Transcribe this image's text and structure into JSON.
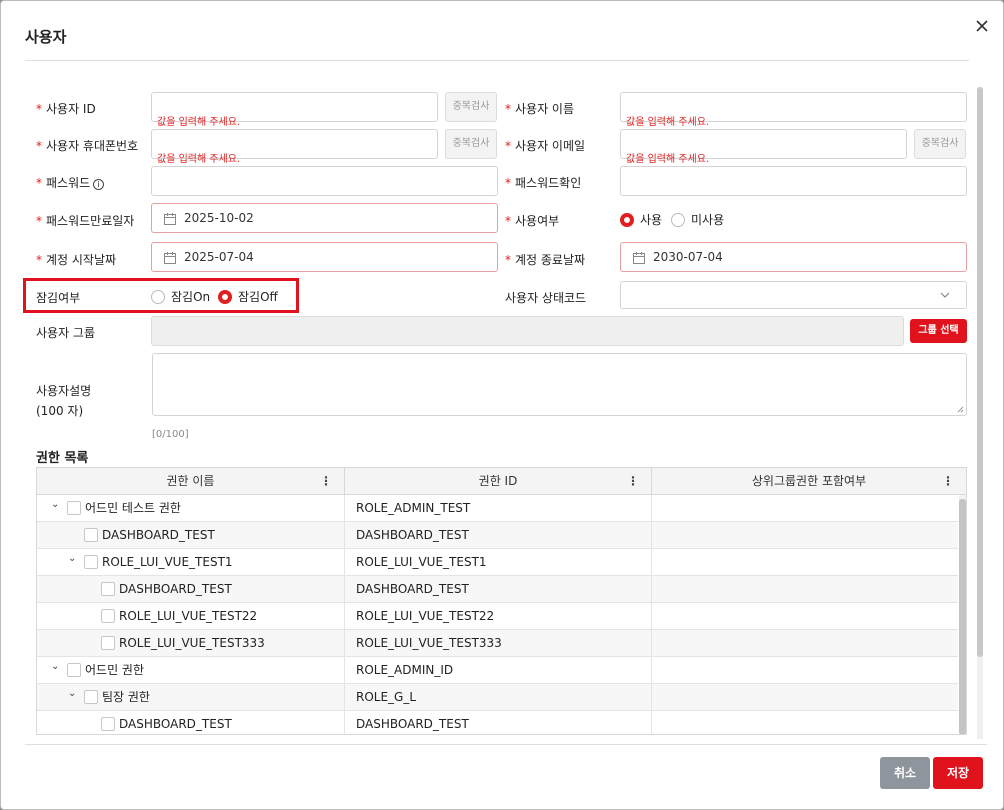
{
  "dialog": {
    "title": "사용자"
  },
  "form": {
    "user_id": {
      "label": "사용자 ID",
      "value": "",
      "error": "값을 입력해 주세요.",
      "dup_check": "중복검사"
    },
    "user_name": {
      "label": "사용자 이름",
      "value": "",
      "error": "값을 입력해 주세요."
    },
    "mobile": {
      "label": "사용자 휴대폰번호",
      "value": "",
      "error": "값을 입력해 주세요.",
      "dup_check": "중복검사"
    },
    "email": {
      "label": "사용자 이메일",
      "value": "",
      "error": "값을 입력해 주세요.",
      "dup_check": "중복검사"
    },
    "password": {
      "label": "패스워드",
      "info_icon": "i",
      "value": ""
    },
    "password_confirm": {
      "label": "패스워드확인",
      "value": ""
    },
    "password_expiry": {
      "label": "패스워드만료일자",
      "value": "2025-10-02"
    },
    "use_yn": {
      "label": "사용여부",
      "options": [
        "사용",
        "미사용"
      ],
      "selected": "사용"
    },
    "account_start": {
      "label": "계정 시작날짜",
      "value": "2025-07-04"
    },
    "account_end": {
      "label": "계정 종료날짜",
      "value": "2030-07-04"
    },
    "lock": {
      "label": "잠김여부",
      "options": [
        "잠김On",
        "잠김Off"
      ],
      "selected": "잠김Off"
    },
    "status_code": {
      "label": "사용자 상태코드",
      "value": ""
    },
    "user_group": {
      "label": "사용자 그룹",
      "value": "",
      "button": "그룹 선택"
    },
    "description": {
      "label_line1": "사용자설명",
      "label_line2": "(100 자)",
      "value": "",
      "counter": "[0/100]"
    }
  },
  "permissions": {
    "title": "권한 목록",
    "columns": [
      "권한 이름",
      "권한 ID",
      "상위그룹권한 포함여부"
    ],
    "kebab": "⋮",
    "rows": [
      {
        "level": 0,
        "expand": "⌄",
        "name": "어드민 테스트 권한",
        "id": "ROLE_ADMIN_TEST",
        "include": ""
      },
      {
        "level": 1,
        "expand": "",
        "name": "DASHBOARD_TEST",
        "id": "DASHBOARD_TEST",
        "include": ""
      },
      {
        "level": 1,
        "expand": "⌄",
        "name": "ROLE_LUI_VUE_TEST1",
        "id": "ROLE_LUI_VUE_TEST1",
        "include": ""
      },
      {
        "level": 2,
        "expand": "",
        "name": "DASHBOARD_TEST",
        "id": "DASHBOARD_TEST",
        "include": ""
      },
      {
        "level": 2,
        "expand": "",
        "name": "ROLE_LUI_VUE_TEST22",
        "id": "ROLE_LUI_VUE_TEST22",
        "include": ""
      },
      {
        "level": 2,
        "expand": "",
        "name": "ROLE_LUI_VUE_TEST333",
        "id": "ROLE_LUI_VUE_TEST333",
        "include": ""
      },
      {
        "level": 0,
        "expand": "⌄",
        "name": "어드민 권한",
        "id": "ROLE_ADMIN_ID",
        "include": ""
      },
      {
        "level": 1,
        "expand": "⌄",
        "name": "팀장 권한",
        "id": "ROLE_G_L",
        "include": ""
      },
      {
        "level": 2,
        "expand": "",
        "name": "DASHBOARD_TEST",
        "id": "DASHBOARD_TEST",
        "include": ""
      }
    ]
  },
  "footer": {
    "cancel": "취소",
    "save": "저장"
  },
  "colors": {
    "accent": "#e0121c",
    "cancel": "#8e959c",
    "error": "#e02020"
  }
}
